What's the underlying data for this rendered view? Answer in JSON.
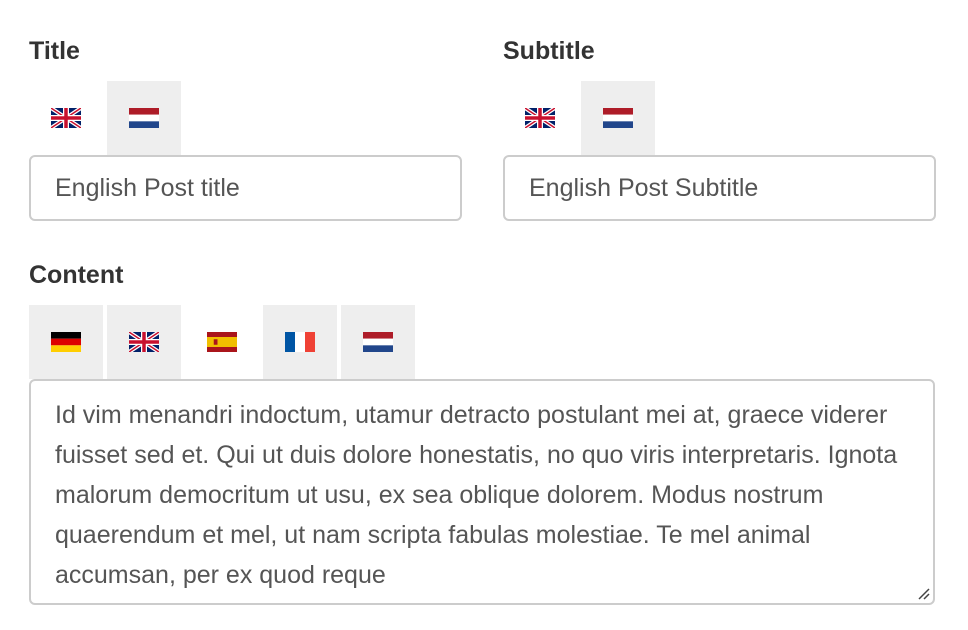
{
  "title_field": {
    "label": "Title",
    "value": "English Post title",
    "tabs": [
      {
        "flag": "uk-flag-icon",
        "active": true
      },
      {
        "flag": "nl-flag-icon",
        "active": false
      }
    ]
  },
  "subtitle_field": {
    "label": "Subtitle",
    "value": "English Post Subtitle",
    "tabs": [
      {
        "flag": "uk-flag-icon",
        "active": true
      },
      {
        "flag": "nl-flag-icon",
        "active": false
      }
    ]
  },
  "content_field": {
    "label": "Content",
    "value": "Id vim menandri indoctum, utamur detracto postulant mei at, graece viderer fuisset sed et. Qui ut duis dolore honestatis, no quo viris interpretaris. Ignota malorum democritum ut usu, ex sea oblique dolorem. Modus nostrum quaerendum et mel, ut nam scripta fabulas molestiae. Te mel animal accumsan, per ex quod reque",
    "tabs": [
      {
        "flag": "de-flag-icon",
        "active": false
      },
      {
        "flag": "uk-flag-icon",
        "active": false
      },
      {
        "flag": "es-flag-icon",
        "active": true
      },
      {
        "flag": "fr-flag-icon",
        "active": false
      },
      {
        "flag": "nl-flag-icon",
        "active": false
      }
    ]
  },
  "colors": {
    "inactive_tab_bg": "#eeeeee",
    "input_border": "#cccccc",
    "label_text": "#333333",
    "input_text": "#555555"
  }
}
